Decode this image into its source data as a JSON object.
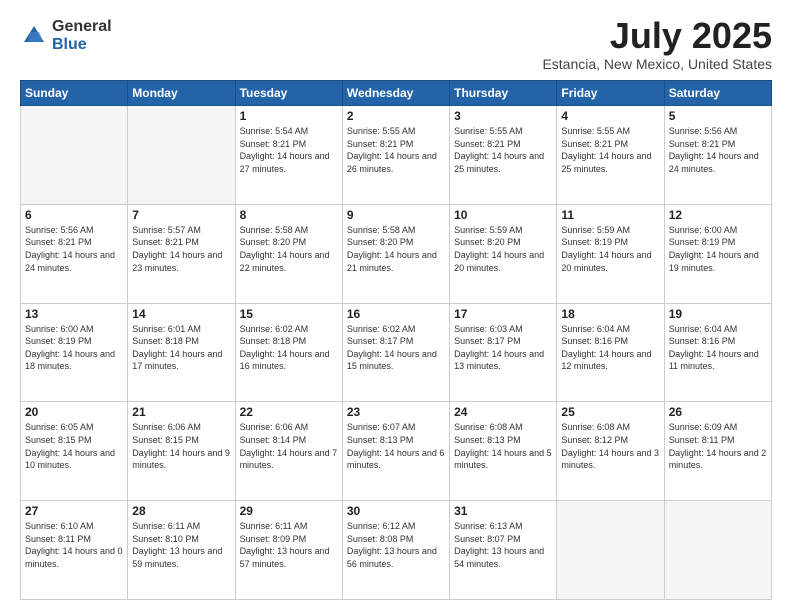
{
  "header": {
    "logo": {
      "general": "General",
      "blue": "Blue"
    },
    "title": "July 2025",
    "location": "Estancia, New Mexico, United States"
  },
  "weekdays": [
    "Sunday",
    "Monday",
    "Tuesday",
    "Wednesday",
    "Thursday",
    "Friday",
    "Saturday"
  ],
  "weeks": [
    [
      {
        "day": "",
        "info": ""
      },
      {
        "day": "",
        "info": ""
      },
      {
        "day": "1",
        "info": "Sunrise: 5:54 AM\nSunset: 8:21 PM\nDaylight: 14 hours and 27 minutes."
      },
      {
        "day": "2",
        "info": "Sunrise: 5:55 AM\nSunset: 8:21 PM\nDaylight: 14 hours and 26 minutes."
      },
      {
        "day": "3",
        "info": "Sunrise: 5:55 AM\nSunset: 8:21 PM\nDaylight: 14 hours and 25 minutes."
      },
      {
        "day": "4",
        "info": "Sunrise: 5:55 AM\nSunset: 8:21 PM\nDaylight: 14 hours and 25 minutes."
      },
      {
        "day": "5",
        "info": "Sunrise: 5:56 AM\nSunset: 8:21 PM\nDaylight: 14 hours and 24 minutes."
      }
    ],
    [
      {
        "day": "6",
        "info": "Sunrise: 5:56 AM\nSunset: 8:21 PM\nDaylight: 14 hours and 24 minutes."
      },
      {
        "day": "7",
        "info": "Sunrise: 5:57 AM\nSunset: 8:21 PM\nDaylight: 14 hours and 23 minutes."
      },
      {
        "day": "8",
        "info": "Sunrise: 5:58 AM\nSunset: 8:20 PM\nDaylight: 14 hours and 22 minutes."
      },
      {
        "day": "9",
        "info": "Sunrise: 5:58 AM\nSunset: 8:20 PM\nDaylight: 14 hours and 21 minutes."
      },
      {
        "day": "10",
        "info": "Sunrise: 5:59 AM\nSunset: 8:20 PM\nDaylight: 14 hours and 20 minutes."
      },
      {
        "day": "11",
        "info": "Sunrise: 5:59 AM\nSunset: 8:19 PM\nDaylight: 14 hours and 20 minutes."
      },
      {
        "day": "12",
        "info": "Sunrise: 6:00 AM\nSunset: 8:19 PM\nDaylight: 14 hours and 19 minutes."
      }
    ],
    [
      {
        "day": "13",
        "info": "Sunrise: 6:00 AM\nSunset: 8:19 PM\nDaylight: 14 hours and 18 minutes."
      },
      {
        "day": "14",
        "info": "Sunrise: 6:01 AM\nSunset: 8:18 PM\nDaylight: 14 hours and 17 minutes."
      },
      {
        "day": "15",
        "info": "Sunrise: 6:02 AM\nSunset: 8:18 PM\nDaylight: 14 hours and 16 minutes."
      },
      {
        "day": "16",
        "info": "Sunrise: 6:02 AM\nSunset: 8:17 PM\nDaylight: 14 hours and 15 minutes."
      },
      {
        "day": "17",
        "info": "Sunrise: 6:03 AM\nSunset: 8:17 PM\nDaylight: 14 hours and 13 minutes."
      },
      {
        "day": "18",
        "info": "Sunrise: 6:04 AM\nSunset: 8:16 PM\nDaylight: 14 hours and 12 minutes."
      },
      {
        "day": "19",
        "info": "Sunrise: 6:04 AM\nSunset: 8:16 PM\nDaylight: 14 hours and 11 minutes."
      }
    ],
    [
      {
        "day": "20",
        "info": "Sunrise: 6:05 AM\nSunset: 8:15 PM\nDaylight: 14 hours and 10 minutes."
      },
      {
        "day": "21",
        "info": "Sunrise: 6:06 AM\nSunset: 8:15 PM\nDaylight: 14 hours and 9 minutes."
      },
      {
        "day": "22",
        "info": "Sunrise: 6:06 AM\nSunset: 8:14 PM\nDaylight: 14 hours and 7 minutes."
      },
      {
        "day": "23",
        "info": "Sunrise: 6:07 AM\nSunset: 8:13 PM\nDaylight: 14 hours and 6 minutes."
      },
      {
        "day": "24",
        "info": "Sunrise: 6:08 AM\nSunset: 8:13 PM\nDaylight: 14 hours and 5 minutes."
      },
      {
        "day": "25",
        "info": "Sunrise: 6:08 AM\nSunset: 8:12 PM\nDaylight: 14 hours and 3 minutes."
      },
      {
        "day": "26",
        "info": "Sunrise: 6:09 AM\nSunset: 8:11 PM\nDaylight: 14 hours and 2 minutes."
      }
    ],
    [
      {
        "day": "27",
        "info": "Sunrise: 6:10 AM\nSunset: 8:11 PM\nDaylight: 14 hours and 0 minutes."
      },
      {
        "day": "28",
        "info": "Sunrise: 6:11 AM\nSunset: 8:10 PM\nDaylight: 13 hours and 59 minutes."
      },
      {
        "day": "29",
        "info": "Sunrise: 6:11 AM\nSunset: 8:09 PM\nDaylight: 13 hours and 57 minutes."
      },
      {
        "day": "30",
        "info": "Sunrise: 6:12 AM\nSunset: 8:08 PM\nDaylight: 13 hours and 56 minutes."
      },
      {
        "day": "31",
        "info": "Sunrise: 6:13 AM\nSunset: 8:07 PM\nDaylight: 13 hours and 54 minutes."
      },
      {
        "day": "",
        "info": ""
      },
      {
        "day": "",
        "info": ""
      }
    ]
  ]
}
